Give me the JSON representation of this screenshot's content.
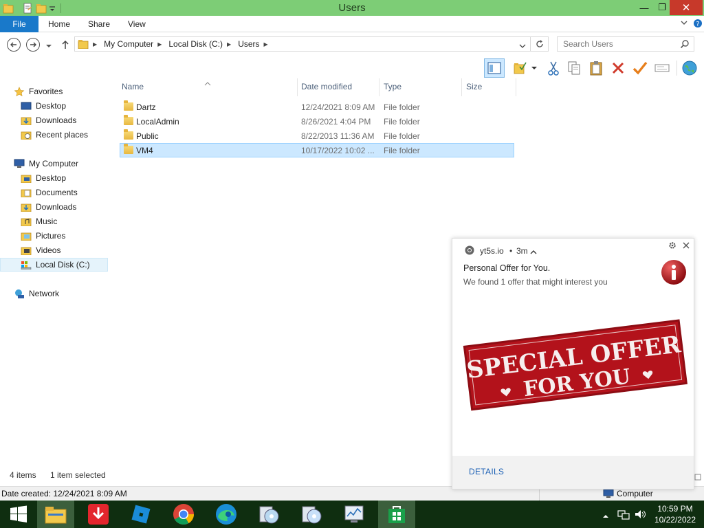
{
  "window": {
    "title": "Users",
    "minimize": "—",
    "maximize": "❐",
    "close": "✕"
  },
  "ribbon": {
    "tabs": [
      "File",
      "Home",
      "Share",
      "View"
    ]
  },
  "address": {
    "crumbs": [
      "My Computer",
      "Local Disk (C:)",
      "Users"
    ],
    "search_placeholder": "Search Users"
  },
  "nav": {
    "favorites": {
      "label": "Favorites",
      "items": [
        "Desktop",
        "Downloads",
        "Recent places"
      ]
    },
    "computer": {
      "label": "My Computer",
      "items": [
        "Desktop",
        "Documents",
        "Downloads",
        "Music",
        "Pictures",
        "Videos",
        "Local Disk (C:)"
      ]
    },
    "network": {
      "label": "Network"
    }
  },
  "files": {
    "columns": [
      "Name",
      "Date modified",
      "Type",
      "Size"
    ],
    "rows": [
      {
        "name": "Dartz",
        "date": "12/24/2021 8:09 AM",
        "type": "File folder"
      },
      {
        "name": "LocalAdmin",
        "date": "8/26/2021 4:04 PM",
        "type": "File folder"
      },
      {
        "name": "Public",
        "date": "8/22/2013 11:36 AM",
        "type": "File folder"
      },
      {
        "name": "VM4",
        "date": "10/17/2022 10:02 ...",
        "type": "File folder"
      }
    ]
  },
  "status": {
    "item_count": "4 items",
    "selected": "1 item selected",
    "date_created": "Date created: 12/24/2021 8:09 AM",
    "location": "Computer"
  },
  "notification": {
    "source": "yt5s.io",
    "dot": "•",
    "age": "3m",
    "title": "Personal Offer for You.",
    "body": "We found 1 offer that might interest you",
    "banner_line1": "SPECIAL OFFER",
    "banner_line2": "FOR YOU",
    "action": "DETAILS"
  },
  "taskbar": {
    "time": "10:59 PM",
    "date": "10/22/2022"
  },
  "colors": {
    "titlebar": "#7dcd76",
    "file_tab": "#1979ca",
    "selection": "#cce8ff",
    "taskbar": "#0f2e10",
    "offer_red": "#b3121b"
  }
}
